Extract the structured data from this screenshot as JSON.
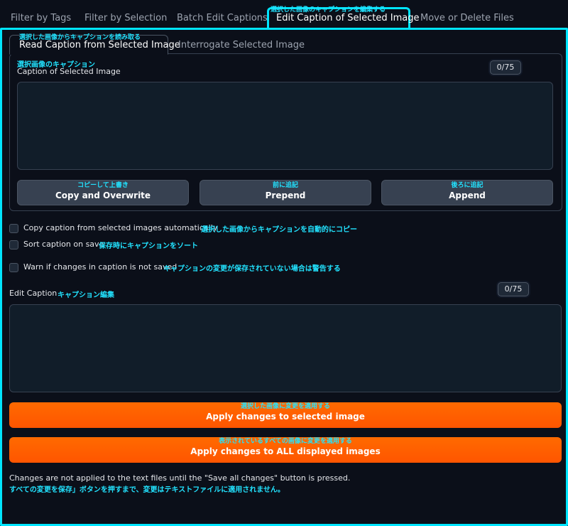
{
  "top_tabs": [
    {
      "label": "Filter by Tags"
    },
    {
      "label": "Filter by Selection"
    },
    {
      "label": "Batch Edit Captions"
    },
    {
      "label": "Edit Caption of Selected Image",
      "jp": "選択した画像のキャプションを編集する",
      "active": true
    },
    {
      "label": "Move or Delete Files"
    }
  ],
  "sub_tabs": [
    {
      "label": "Read Caption from Selected Image",
      "jp": "選択した画像からキャプションを読み取る",
      "active": true
    },
    {
      "label": "Interrogate Selected Image"
    }
  ],
  "caption_section": {
    "label_jp": "選択画像のキャプション",
    "label": "Caption of Selected Image",
    "counter": "0/75",
    "value": ""
  },
  "read_buttons": [
    {
      "label": "Copy and Overwrite",
      "jp": "コピーして上書き"
    },
    {
      "label": "Prepend",
      "jp": "前に追記"
    },
    {
      "label": "Append",
      "jp": "後ろに追記"
    }
  ],
  "checkboxes": [
    {
      "label": "Copy caption from selected images automatically",
      "jp": "選択した画像からキャプションを自動的にコピー",
      "checked": false
    },
    {
      "label": "Sort caption on save",
      "jp": "保存時にキャプションをソート",
      "checked": false
    },
    {
      "label": "Warn if changes in caption is not saved",
      "jp": "キャプションの変更が保存されていない場合は警告する",
      "checked": false
    }
  ],
  "edit_section": {
    "label": "Edit Caption",
    "label_jp": "キャプション編集",
    "counter": "0/75",
    "value": ""
  },
  "apply_buttons": [
    {
      "label": "Apply changes to selected image",
      "jp": "選択した画像に変更を適用する"
    },
    {
      "label": "Apply changes to ALL displayed images",
      "jp": "表示されているすべての画像に変更を適用する"
    }
  ],
  "note": {
    "en": "Changes are not applied to the text files until the \"Save all changes\" button is pressed.",
    "jp": "すべての変更を保存」ボタンを押すまで、変更はテキストファイルに適用されません。"
  },
  "colors": {
    "accent": "#00e5ff",
    "jp_text": "#22e3ff",
    "orange": "#ff5f00",
    "background": "#0b0f19"
  }
}
